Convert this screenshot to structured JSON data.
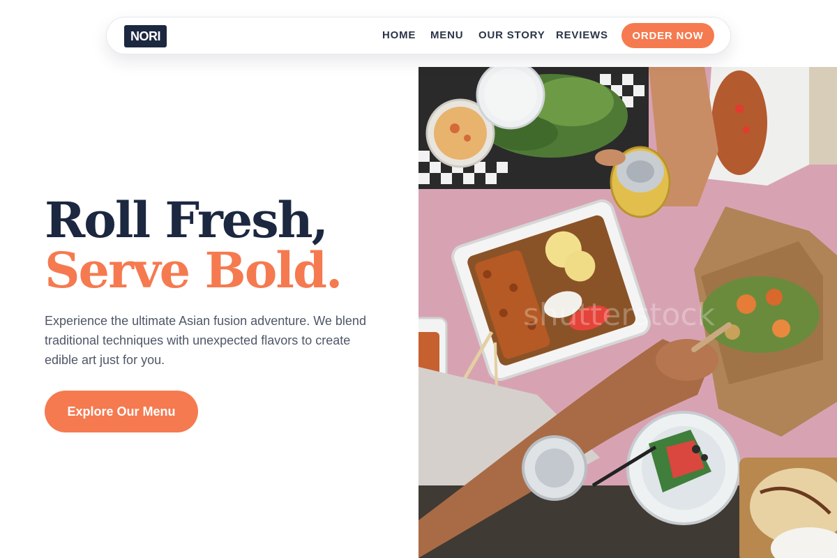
{
  "nav": {
    "logo": "NORI",
    "links": [
      "HOME",
      "MENU",
      "OUR STORY",
      "REVIEWS"
    ],
    "cta": "ORDER NOW"
  },
  "hero": {
    "headline_line1": "Roll Fresh,",
    "headline_line2": "Serve Bold.",
    "description": "Experience the ultimate Asian fusion adventure. We blend traditional techniques with unexpected flavors to create edible art just for you.",
    "cta": "Explore Our Menu"
  },
  "image": {
    "watermark": "shutterstock"
  },
  "colors": {
    "brand_dark": "#1c2740",
    "accent": "#f57a50",
    "body_text": "#4e5667"
  }
}
